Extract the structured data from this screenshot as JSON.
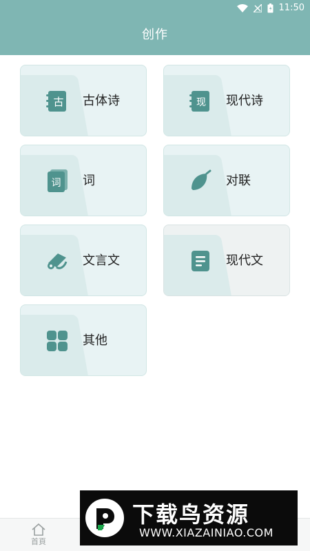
{
  "status_bar": {
    "time": "11:50"
  },
  "header": {
    "title": "创作"
  },
  "cards": [
    {
      "label": "古体诗",
      "icon": "gu-book-icon"
    },
    {
      "label": "现代诗",
      "icon": "xian-book-icon"
    },
    {
      "label": "词",
      "icon": "ci-book-icon"
    },
    {
      "label": "对联",
      "icon": "leaf-icon"
    },
    {
      "label": "文言文",
      "icon": "scroll-icon"
    },
    {
      "label": "现代文",
      "icon": "document-icon"
    },
    {
      "label": "其他",
      "icon": "grid-icon"
    }
  ],
  "icon_text": {
    "gu": "古",
    "xian": "现",
    "ci": "词"
  },
  "bottom_nav": [
    {
      "label": "首頁",
      "icon": "home-icon"
    },
    {
      "label": "",
      "icon": "tab-icon"
    },
    {
      "label": "",
      "icon": "tab-icon"
    },
    {
      "label": "",
      "icon": "tab-icon"
    }
  ],
  "watermark": {
    "brand": "下载鸟资源",
    "url": "WWW.XIAZAINIAO.COM"
  },
  "colors": {
    "primary": "#7fb6b3",
    "icon": "#4f938e",
    "card_bg": "#e8f3f4"
  }
}
